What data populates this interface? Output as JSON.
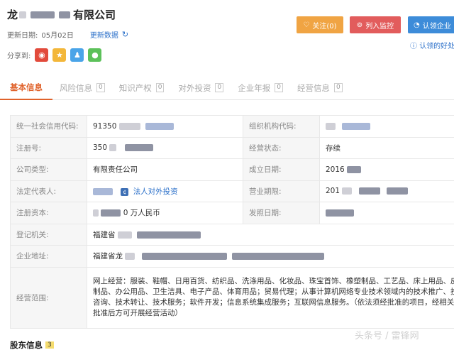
{
  "company": {
    "name_prefix": "龙",
    "name_suffix": "有限公司"
  },
  "meta": {
    "update_label": "更新日期:",
    "update_date": "05月02日",
    "update_link": "更新数据"
  },
  "share": {
    "label": "分享到:"
  },
  "actions": {
    "follow": "关注(0)",
    "monitor": "列入监控",
    "claim": "认领企业",
    "claim_link": "认领的好处"
  },
  "tabs": [
    {
      "label": "基本信息",
      "count": ""
    },
    {
      "label": "风险信息",
      "count": "0"
    },
    {
      "label": "知识产权",
      "count": "0"
    },
    {
      "label": "对外投资",
      "count": "0"
    },
    {
      "label": "企业年报",
      "count": "0"
    },
    {
      "label": "经营信息",
      "count": "0"
    }
  ],
  "info": {
    "credit_code_label": "统一社会信用代码:",
    "credit_code_value": "91350",
    "org_code_label": "组织机构代码:",
    "reg_no_label": "注册号:",
    "reg_no_value": "350",
    "status_label": "经营状态:",
    "status_value": "存续",
    "type_label": "公司类型:",
    "type_value": "有限责任公司",
    "founded_label": "成立日期:",
    "founded_value": "2016",
    "legal_label": "法定代表人:",
    "legal_link": "法人对外投资",
    "term_label": "营业期限:",
    "term_value": "201",
    "capital_label": "注册资本:",
    "capital_value": "0 万人民币",
    "issue_label": "发照日期:",
    "authority_label": "登记机关:",
    "authority_value": "福建省",
    "address_label": "企业地址:",
    "address_value": "福建省龙",
    "scope_label": "经营范围:",
    "scope_value": "网上经营：服装、鞋帽、日用百货、纺织品、洗涤用品、化妆品、珠宝首饰、橡塑制品、工艺品、床上用品、皮革制品、办公用品、卫生洁具、电子产品、体育用品；贸易代理；从事计算机网络专业技术领域内的技术推广、技术咨询、技术转让、技术服务；软件开发；信息系统集成服务；互联网信息服务。（依法须经批准的项目，经相关部门批准后方可开展经营活动）"
  },
  "shareholders": {
    "title": "股东信息",
    "count": "3"
  },
  "watermark": "头条号 / 雷锋网",
  "colors": {
    "accent_tab": "#e0622b",
    "follow": "#f0a443",
    "monitor": "#e25c5c",
    "claim": "#3d8cd9"
  }
}
